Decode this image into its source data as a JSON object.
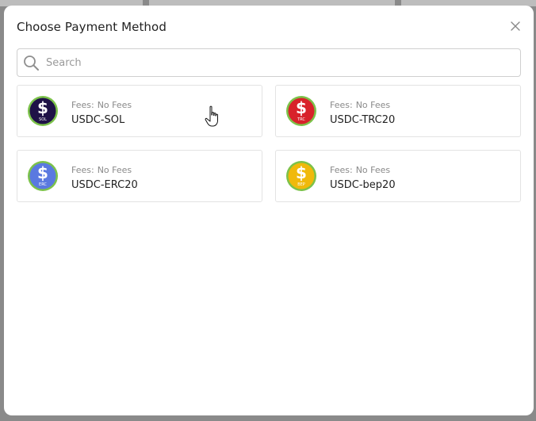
{
  "modal": {
    "title": "Choose Payment Method",
    "close_icon": "close-icon"
  },
  "search": {
    "placeholder": "Search",
    "value": "",
    "icon": "search-icon"
  },
  "fees_label": "Fees:",
  "methods": [
    {
      "name": "USDC-SOL",
      "fees": "No Fees",
      "badge": "SOL",
      "color": "#1f1247",
      "ring": "#7cc24a"
    },
    {
      "name": "USDC-TRC20",
      "fees": "No Fees",
      "badge": "TRC",
      "color": "#d8222a",
      "ring": "#7cc24a"
    },
    {
      "name": "USDC-ERC20",
      "fees": "No Fees",
      "badge": "ERC",
      "color": "#5a79e0",
      "ring": "#7cc24a"
    },
    {
      "name": "USDC-bep20",
      "fees": "No Fees",
      "badge": "BEP",
      "color": "#f0b90b",
      "ring": "#7cc24a"
    }
  ],
  "colors": {
    "overlay": "#7c7c7c",
    "modal_bg": "#ffffff",
    "card_border": "#e3e3e3"
  }
}
